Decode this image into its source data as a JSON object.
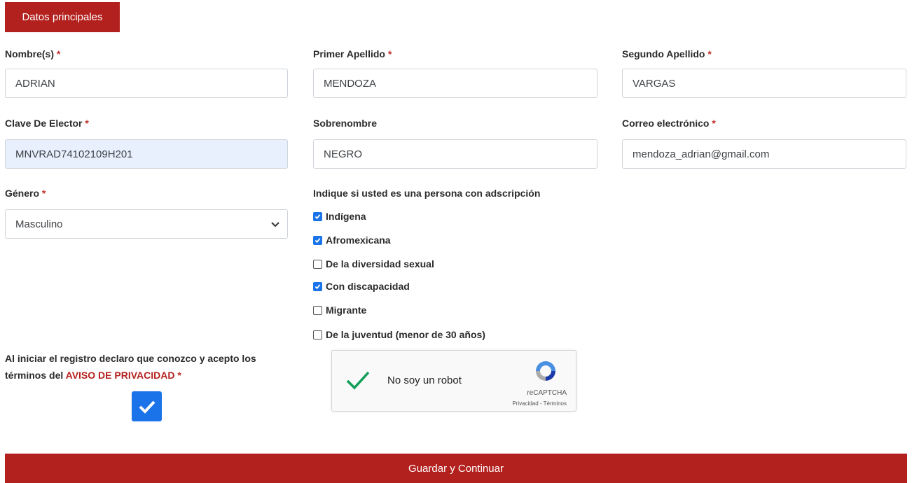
{
  "tab": {
    "label": "Datos principales"
  },
  "fields": {
    "nombre": {
      "label": "Nombre(s)",
      "required": "*",
      "value": "ADRIAN"
    },
    "primer_apellido": {
      "label": "Primer Apellido",
      "required": "*",
      "value": "MENDOZA"
    },
    "segundo_apellido": {
      "label": "Segundo Apellido",
      "required": "*",
      "value": "VARGAS"
    },
    "clave_elector": {
      "label": "Clave De Elector",
      "required": "*",
      "value": "MNVRAD74102109H201"
    },
    "sobrenombre": {
      "label": "Sobrenombre",
      "value": "NEGRO"
    },
    "correo": {
      "label": "Correo electrónico",
      "required": "*",
      "value": "mendoza_adrian@gmail.com"
    },
    "genero": {
      "label": "Género",
      "required": "*",
      "value": "Masculino"
    }
  },
  "adscripcion": {
    "label": "Indique si usted es una persona con adscripción",
    "options": [
      {
        "label": "Indígena",
        "checked": true
      },
      {
        "label": "Afromexicana",
        "checked": true
      },
      {
        "label": "De la diversidad sexual",
        "checked": false
      },
      {
        "label": "Con discapacidad",
        "checked": true
      },
      {
        "label": "Migrante",
        "checked": false
      },
      {
        "label": "De la juventud (menor de 30 años)",
        "checked": false
      }
    ]
  },
  "privacy": {
    "text": "Al iniciar el registro declaro que conozco y acepto los términos del",
    "link": "AVISO DE PRIVACIDAD",
    "required": "*",
    "checked": true
  },
  "captcha": {
    "label": "No soy un robot",
    "brand": "reCAPTCHA",
    "links": "Privacidad - Términos",
    "checked": true
  },
  "submit": {
    "label": "Guardar y Continuar"
  },
  "colors": {
    "brand": "#b3211e",
    "check": "#1a73e8",
    "captcha_check": "#0f9d58"
  }
}
